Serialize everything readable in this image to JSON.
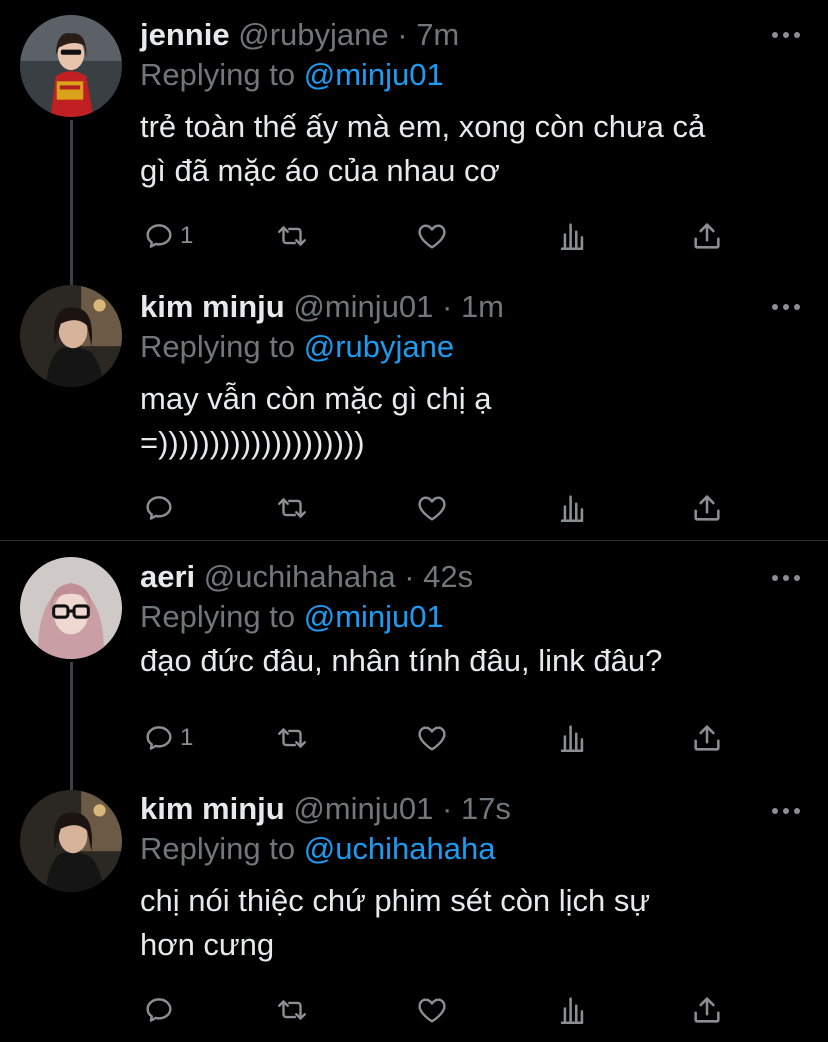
{
  "tweets": [
    {
      "name": "jennie",
      "handle": "@rubyjane",
      "dot": "·",
      "time": "7m",
      "replying_prefix": "Replying to",
      "replying_to": "@minju01",
      "text": "trẻ toàn thế ấy mà em, xong còn chưa cả\ngì đã mặc áo của nhau cơ",
      "reply_count": "1"
    },
    {
      "name": "kim minju",
      "handle": "@minju01",
      "dot": "·",
      "time": "1m",
      "replying_prefix": "Replying to",
      "replying_to": "@rubyjane",
      "text": "may vẫn còn mặc gì chị ạ\n=))))))))))))))))))))",
      "reply_count": ""
    },
    {
      "name": "aeri",
      "handle": "@uchihahaha",
      "dot": "·",
      "time": "42s",
      "replying_prefix": "Replying to",
      "replying_to": "@minju01",
      "text": "đạo đức đâu, nhân tính đâu, link đâu?",
      "reply_count": "1"
    },
    {
      "name": "kim minju",
      "handle": "@minju01",
      "dot": "·",
      "time": "17s",
      "replying_prefix": "Replying to",
      "replying_to": "@uchihahaha",
      "text": "chị nói thiệc chứ phim sét còn lịch sự\nhơn cưng",
      "reply_count": ""
    }
  ],
  "colors": {
    "background": "#000000",
    "text": "#e7e9ea",
    "muted": "#71767b",
    "link": "#1d9bf0",
    "icon": "#8b8f94"
  }
}
